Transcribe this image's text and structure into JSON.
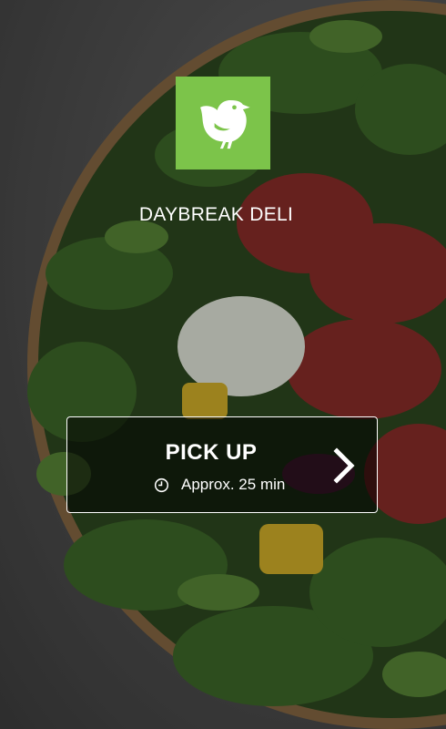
{
  "brand": {
    "name": "DAYBREAK DELI",
    "logo_icon": "bird-icon",
    "logo_color": "#7cc44a"
  },
  "pickup": {
    "title": "PICK UP",
    "time_icon": "clock-icon",
    "time_text": "Approx. 25 min",
    "chevron_icon": "chevron-right-icon"
  },
  "background": {
    "image": "salad-bowl-photo"
  }
}
